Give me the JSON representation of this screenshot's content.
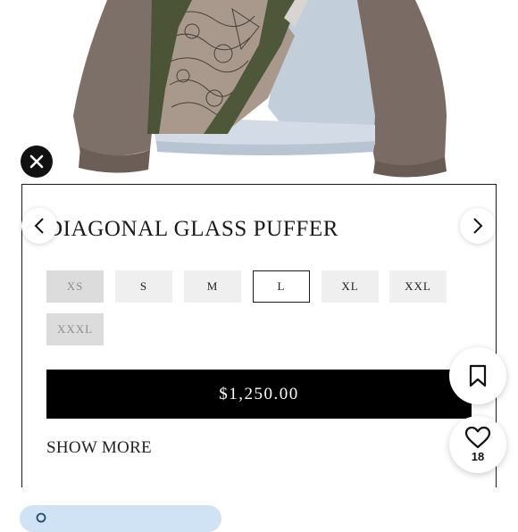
{
  "product": {
    "image_alt": "Diagonal glass puffer jacket product photo",
    "title": "DIAGONAL GLASS PUFFER",
    "price": "$1,250.00"
  },
  "sizes": [
    {
      "label": "XS",
      "state": "unavailable"
    },
    {
      "label": "S",
      "state": "available"
    },
    {
      "label": "M",
      "state": "available"
    },
    {
      "label": "L",
      "state": "selected"
    },
    {
      "label": "XL",
      "state": "available"
    },
    {
      "label": "XXL",
      "state": "available"
    },
    {
      "label": "XXXL",
      "state": "unavailable"
    }
  ],
  "actions": {
    "show_more_label": "SHOW MORE",
    "like_count": "18"
  },
  "icons": {
    "close": "close-icon",
    "prev": "chevron-left-icon",
    "next": "chevron-right-icon",
    "bookmark": "bookmark-icon",
    "like": "heart-icon",
    "search": "search-icon"
  },
  "colors": {
    "buy_button": "#000000",
    "chip_available": "#efefef",
    "chip_unavailable": "#dcdcdc",
    "bottom_pill": "#cfe3f5"
  }
}
